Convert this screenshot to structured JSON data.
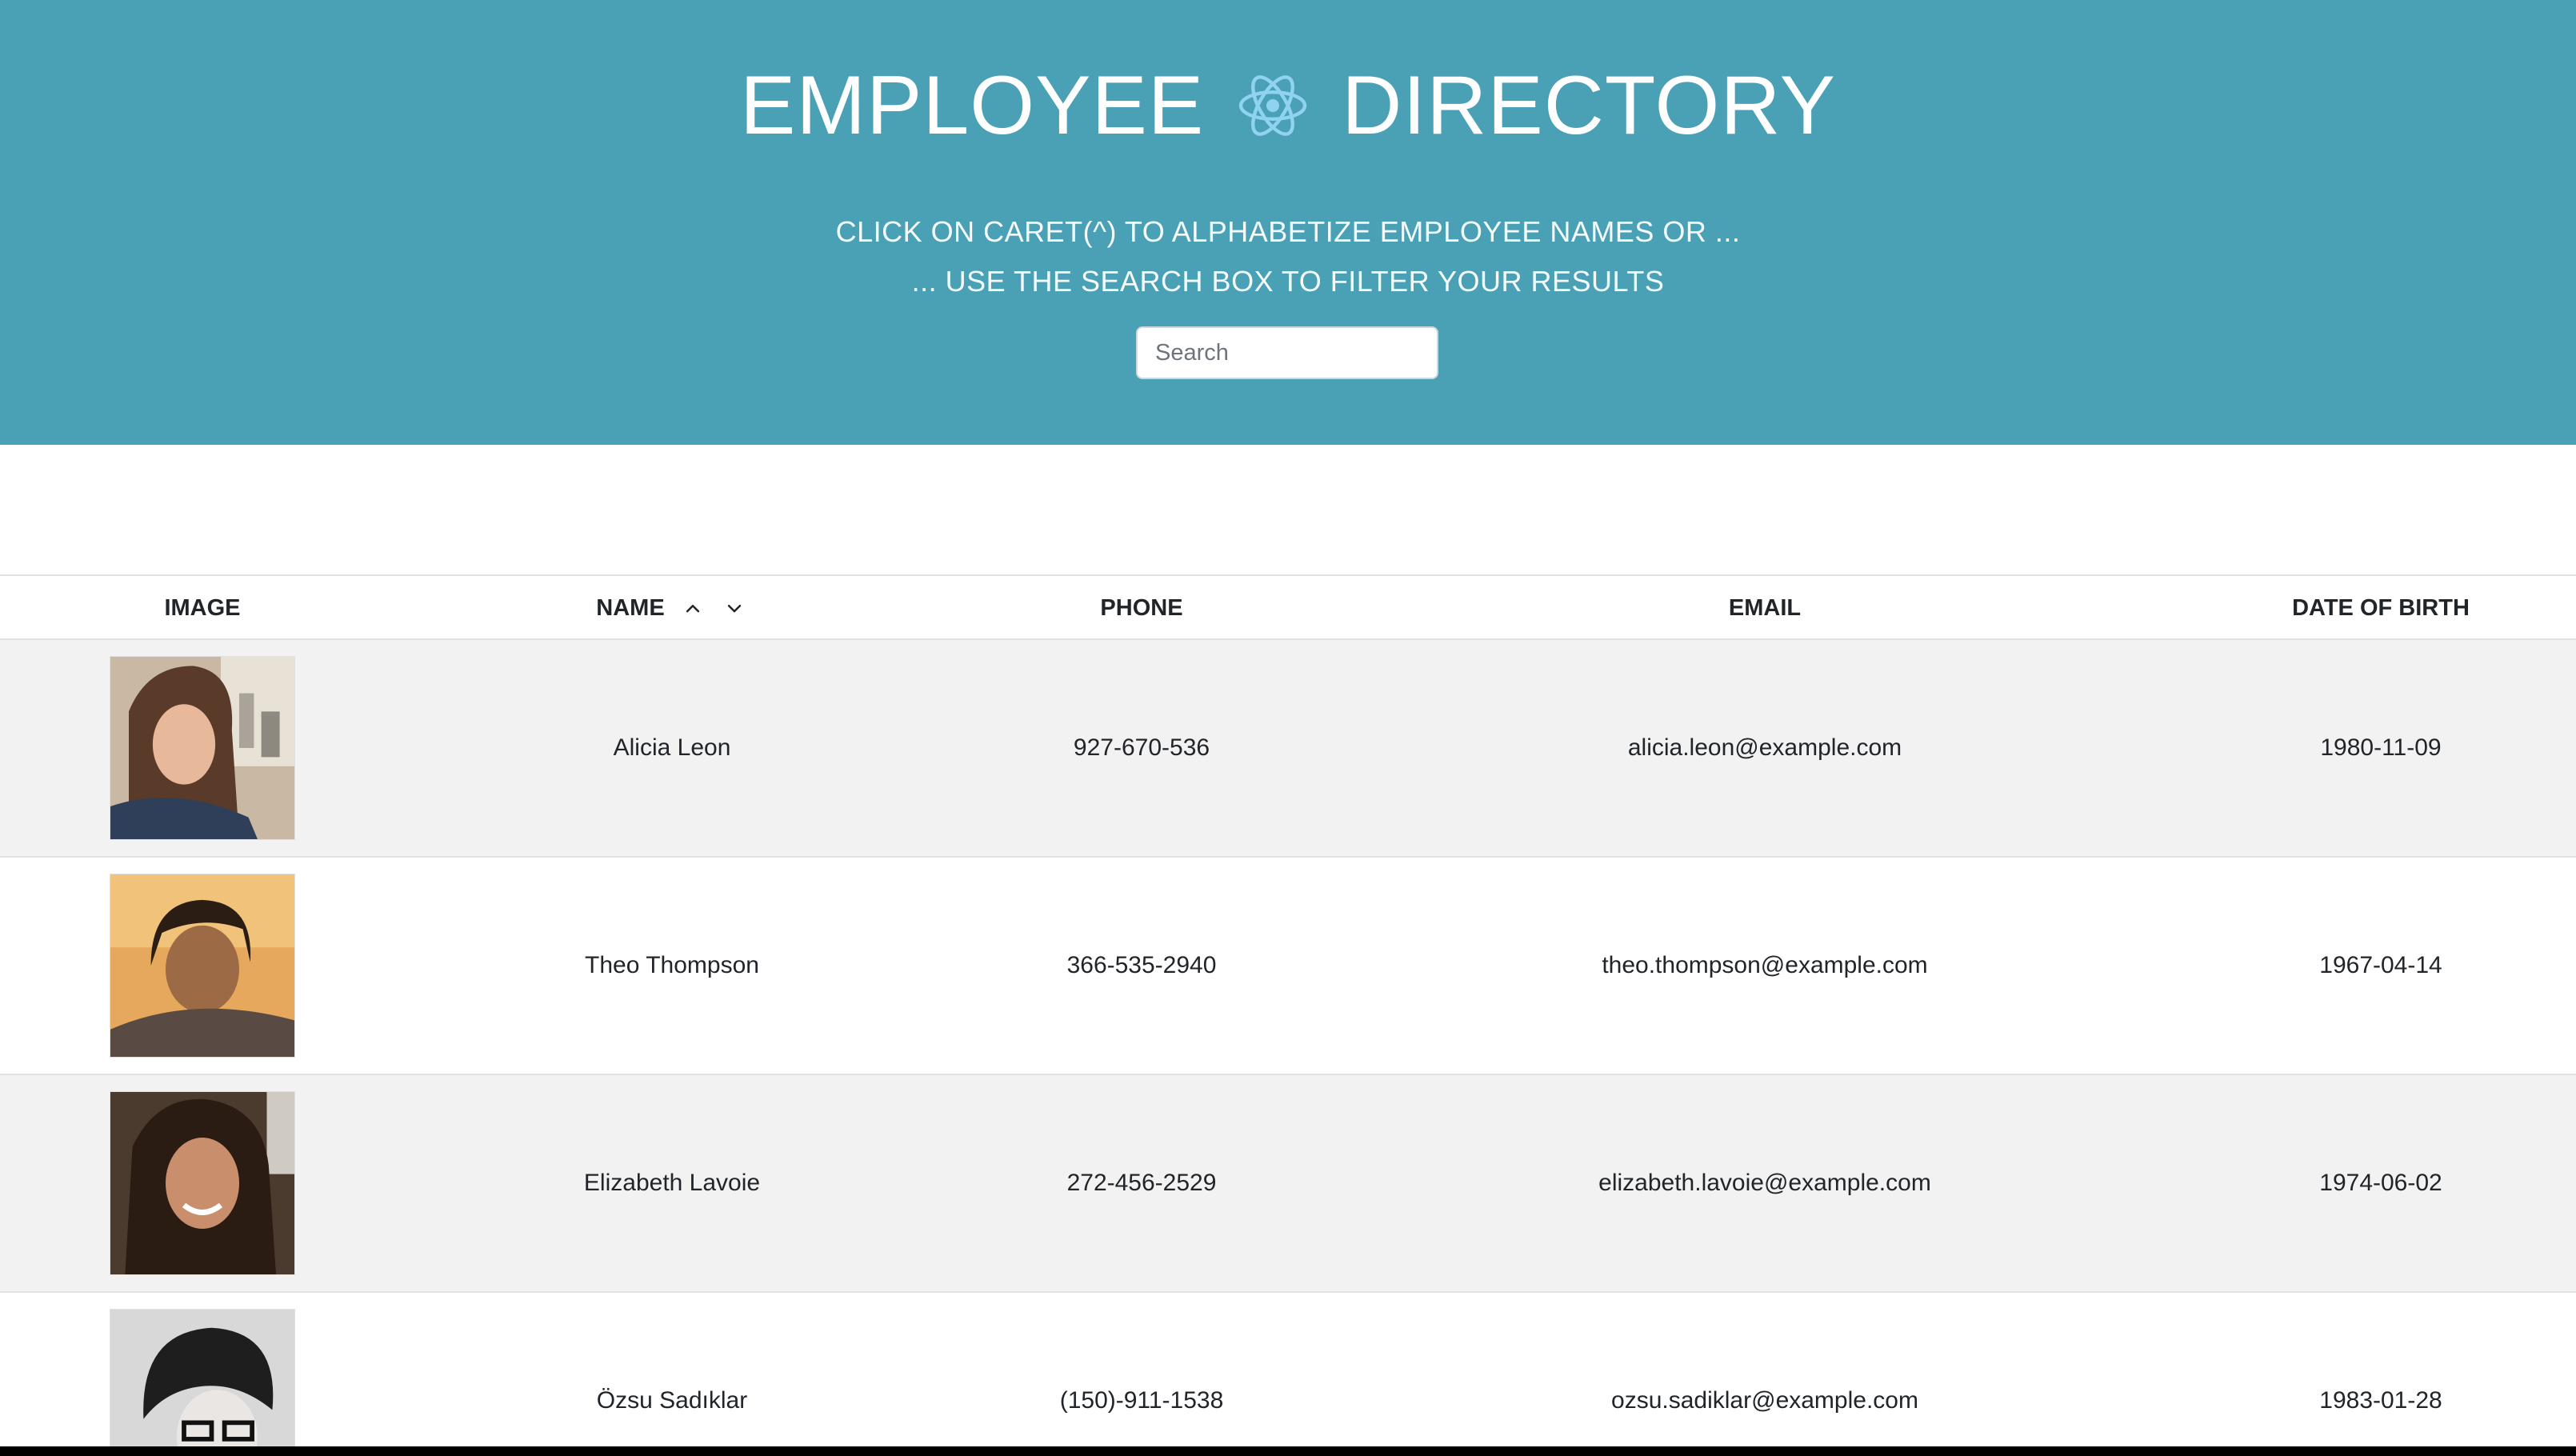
{
  "header": {
    "title_left": "EMPLOYEE",
    "title_right": "DIRECTORY",
    "logo_icon": "react-atom-icon",
    "instruction_line1": "CLICK ON CARET(^) TO ALPHABETIZE EMPLOYEE NAMES OR ...",
    "instruction_line2": "... USE THE SEARCH BOX TO FILTER YOUR RESULTS",
    "search": {
      "placeholder": "Search",
      "value": ""
    }
  },
  "table": {
    "columns": {
      "image": "IMAGE",
      "name": "NAME",
      "phone": "PHONE",
      "email": "EMAIL",
      "dob": "DATE OF BIRTH"
    },
    "sort_icons": [
      "caret-up-icon",
      "caret-down-icon"
    ],
    "rows": [
      {
        "name": "Alicia Leon",
        "phone": "927-670-536",
        "email": "alicia.leon@example.com",
        "dob": "1980-11-09",
        "image_icon": "employee-photo"
      },
      {
        "name": "Theo Thompson",
        "phone": "366-535-2940",
        "email": "theo.thompson@example.com",
        "dob": "1967-04-14",
        "image_icon": "employee-photo"
      },
      {
        "name": "Elizabeth Lavoie",
        "phone": "272-456-2529",
        "email": "elizabeth.lavoie@example.com",
        "dob": "1974-06-02",
        "image_icon": "employee-photo"
      },
      {
        "name": "Özsu Sadıklar",
        "phone": "(150)-911-1538",
        "email": "ozsu.sadiklar@example.com",
        "dob": "1983-01-28",
        "image_icon": "employee-photo"
      }
    ]
  },
  "colors": {
    "banner": "#4aa0b5",
    "atom": "#8fd3f0",
    "row_alt": "#f2f2f2",
    "text": "#212529"
  }
}
